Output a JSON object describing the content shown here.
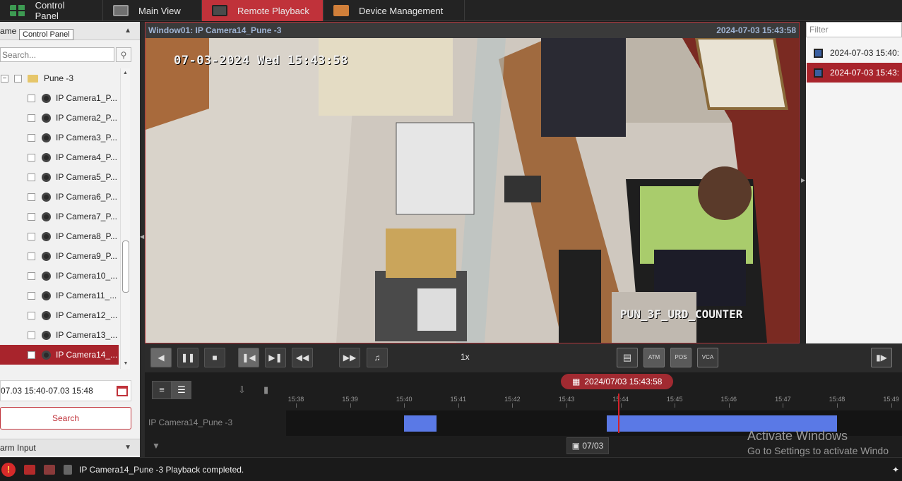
{
  "tabs": [
    {
      "label": "Control Panel",
      "icon": "grid-icon"
    },
    {
      "label": "Main View",
      "icon": "camera-view-icon"
    },
    {
      "label": "Remote Playback",
      "icon": "playback-icon",
      "active": true
    },
    {
      "label": "Device Management",
      "icon": "device-icon"
    }
  ],
  "left_panel": {
    "header_label": "ame",
    "tooltip": "Control Panel",
    "search_placeholder": "Search...",
    "group": {
      "label": "Pune -3"
    },
    "cameras": [
      "IP Camera1_P...",
      "IP Camera2_P...",
      "IP Camera3_P...",
      "IP Camera4_P...",
      "IP Camera5_P...",
      "IP Camera6_P...",
      "IP Camera7_P...",
      "IP Camera8_P...",
      "IP Camera9_P...",
      "IP Camera10_...",
      "IP Camera11_...",
      "IP Camera12_...",
      "IP Camera13_...",
      "IP Camera14_..."
    ],
    "selected_camera_index": 13,
    "time_range": "07.03 15:40-07.03 15:48",
    "search_button": "Search",
    "alarm_input_label": "arm Input"
  },
  "video": {
    "window_title": "Window01: IP Camera14_Pune -3",
    "timestamp": "2024-07-03 15:43:58",
    "osd_date": "07-03-2024 Wed 15:43:58",
    "osd_name": "PUN_3F_URD_COUNTER"
  },
  "right_panel": {
    "filter_placeholder": "Filter",
    "files": [
      "2024-07-03 15:40:",
      "2024-07-03 15:43:"
    ],
    "selected_file_index": 1
  },
  "controls": {
    "speed": "1x",
    "intel_buttons": [
      "ATM",
      "POS",
      "VCA"
    ]
  },
  "timeline": {
    "current_datetime": "2024/07/03 15:43:58",
    "ticks": [
      "15:38",
      "15:39",
      "15:40",
      "15:41",
      "15:42",
      "15:43",
      "15:44",
      "15:45",
      "15:46",
      "15:47",
      "15:48",
      "15:49"
    ],
    "track_label": "IP Camera14_Pune -3",
    "day_chip": "07/03",
    "segments_minutes": [
      [
        15.4,
        15.406
      ],
      [
        15.4375,
        15.48
      ]
    ],
    "cursor_time": "15:43:58"
  },
  "watermark": {
    "line1": "Activate Windows",
    "line2": "Go to Settings to activate Windo"
  },
  "status": {
    "message": "IP Camera14_Pune -3 Playback completed."
  },
  "colors": {
    "accent": "#c0323a",
    "segment": "#5a79e6"
  }
}
